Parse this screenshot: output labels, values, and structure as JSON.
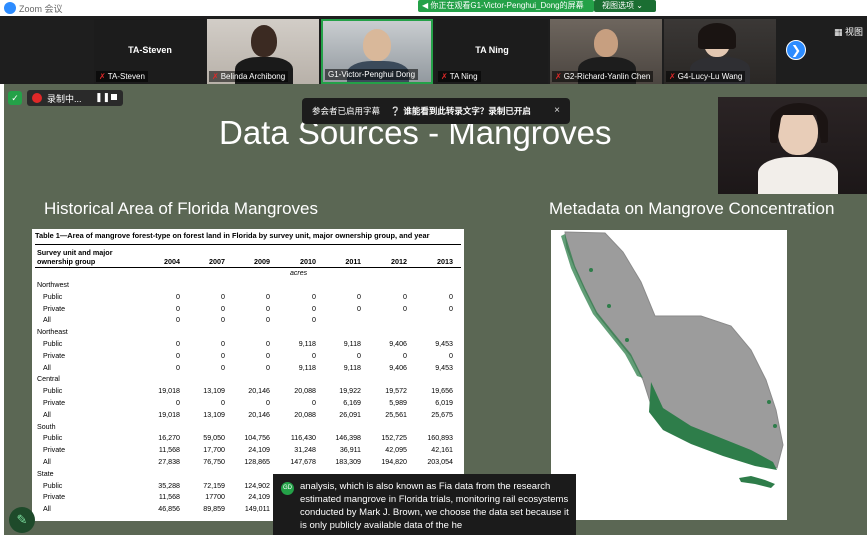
{
  "app": {
    "title": "Zoom 会议",
    "share_banner": "◀ 你正在观看G1-Victor-Penghui_Dong的屏幕",
    "view_options": "视图选项 ⌄",
    "view_button": "▦ 视图"
  },
  "participants": [
    {
      "name_large": "TA-Steven",
      "label": "TA-Steven",
      "video": false
    },
    {
      "name_large": "",
      "label": "Belinda Archibong",
      "video": true
    },
    {
      "name_large": "",
      "label": "G1-Victor-Penghui Dong",
      "video": true
    },
    {
      "name_large": "TA Ning",
      "label": "TA Ning",
      "video": false
    },
    {
      "name_large": "",
      "label": "G2-Richard-Yanlin Chen",
      "video": true
    },
    {
      "name_large": "",
      "label": "G4-Lucy-Lu Wang",
      "video": true
    }
  ],
  "next_page_icon": "❯",
  "recording": {
    "status": "录制中...",
    "pause": "❚❚"
  },
  "captions_notice": {
    "text": "参会者已启用字幕",
    "question": "谁能看到此转录文字？录制已开启",
    "close": "×"
  },
  "slide": {
    "title": "Data Sources - Mangroves",
    "left_heading": "Historical Area of Florida Mangroves",
    "right_heading": "Metadata on Mangrove Concentration"
  },
  "table": {
    "caption": "Table 1—Area of mangrove forest-type on forest land in Florida by survey unit, major ownership group, and year",
    "header_line1": "Survey unit and major",
    "header_line2": "ownership group",
    "years": [
      "2004",
      "2007",
      "2009",
      "2010",
      "2011",
      "2012",
      "2013"
    ],
    "units": "acres",
    "sections": [
      {
        "name": "Northwest",
        "rows": [
          {
            "label": "Public",
            "values": [
              "0",
              "0",
              "0",
              "0",
              "0",
              "0",
              "0"
            ]
          },
          {
            "label": "Private",
            "values": [
              "0",
              "0",
              "0",
              "0",
              "0",
              "0",
              "0"
            ]
          },
          {
            "label": "All",
            "values": [
              "0",
              "0",
              "0",
              "0",
              "",
              "",
              ""
            ]
          }
        ]
      },
      {
        "name": "Northeast",
        "rows": [
          {
            "label": "Public",
            "values": [
              "0",
              "0",
              "0",
              "9,118",
              "9,118",
              "9,406",
              "9,453"
            ]
          },
          {
            "label": "Private",
            "values": [
              "0",
              "0",
              "0",
              "0",
              "0",
              "0",
              "0"
            ]
          },
          {
            "label": "All",
            "values": [
              "0",
              "0",
              "0",
              "9,118",
              "9,118",
              "9,406",
              "9,453"
            ]
          }
        ]
      },
      {
        "name": "Central",
        "rows": [
          {
            "label": "Public",
            "values": [
              "19,018",
              "13,109",
              "20,146",
              "20,088",
              "19,922",
              "19,572",
              "19,656"
            ]
          },
          {
            "label": "Private",
            "values": [
              "0",
              "0",
              "0",
              "0",
              "6,169",
              "5,989",
              "6,019"
            ]
          },
          {
            "label": "All",
            "values": [
              "19,018",
              "13,109",
              "20,146",
              "20,088",
              "26,091",
              "25,561",
              "25,675"
            ]
          }
        ]
      },
      {
        "name": "South",
        "rows": [
          {
            "label": "Public",
            "values": [
              "16,270",
              "59,050",
              "104,756",
              "116,430",
              "146,398",
              "152,725",
              "160,893"
            ]
          },
          {
            "label": "Private",
            "values": [
              "11,568",
              "17,700",
              "24,109",
              "31,248",
              "36,911",
              "42,095",
              "42,161"
            ]
          },
          {
            "label": "All",
            "values": [
              "27,838",
              "76,750",
              "128,865",
              "147,678",
              "183,309",
              "194,820",
              "203,054"
            ]
          }
        ]
      },
      {
        "name": "State",
        "rows": [
          {
            "label": "Public",
            "values": [
              "35,288",
              "72,159",
              "124,902",
              "",
              "",
              "",
              ""
            ]
          },
          {
            "label": "Private",
            "values": [
              "11,568",
              "17700",
              "24,109",
              "",
              "",
              "",
              ""
            ]
          },
          {
            "label": "All",
            "values": [
              "46,856",
              "89,859",
              "149,011",
              "",
              "",
              "",
              ""
            ]
          }
        ]
      }
    ]
  },
  "live_caption": {
    "badge": "GD",
    "text": "analysis, which is also known as Fia data from the research estimated mangrove in Florida trials, monitoring rail ecosystems conducted by Mark J. Brown, we choose the data set because it is only publicly available data of the he"
  },
  "annotate_icon": "✎",
  "colors": {
    "slide_bg": "#5b6754",
    "zoom_blue": "#2d8cff",
    "share_green": "#24a148",
    "mangrove_green": "#2e7d4a",
    "land_gray": "#9c9c9c"
  }
}
